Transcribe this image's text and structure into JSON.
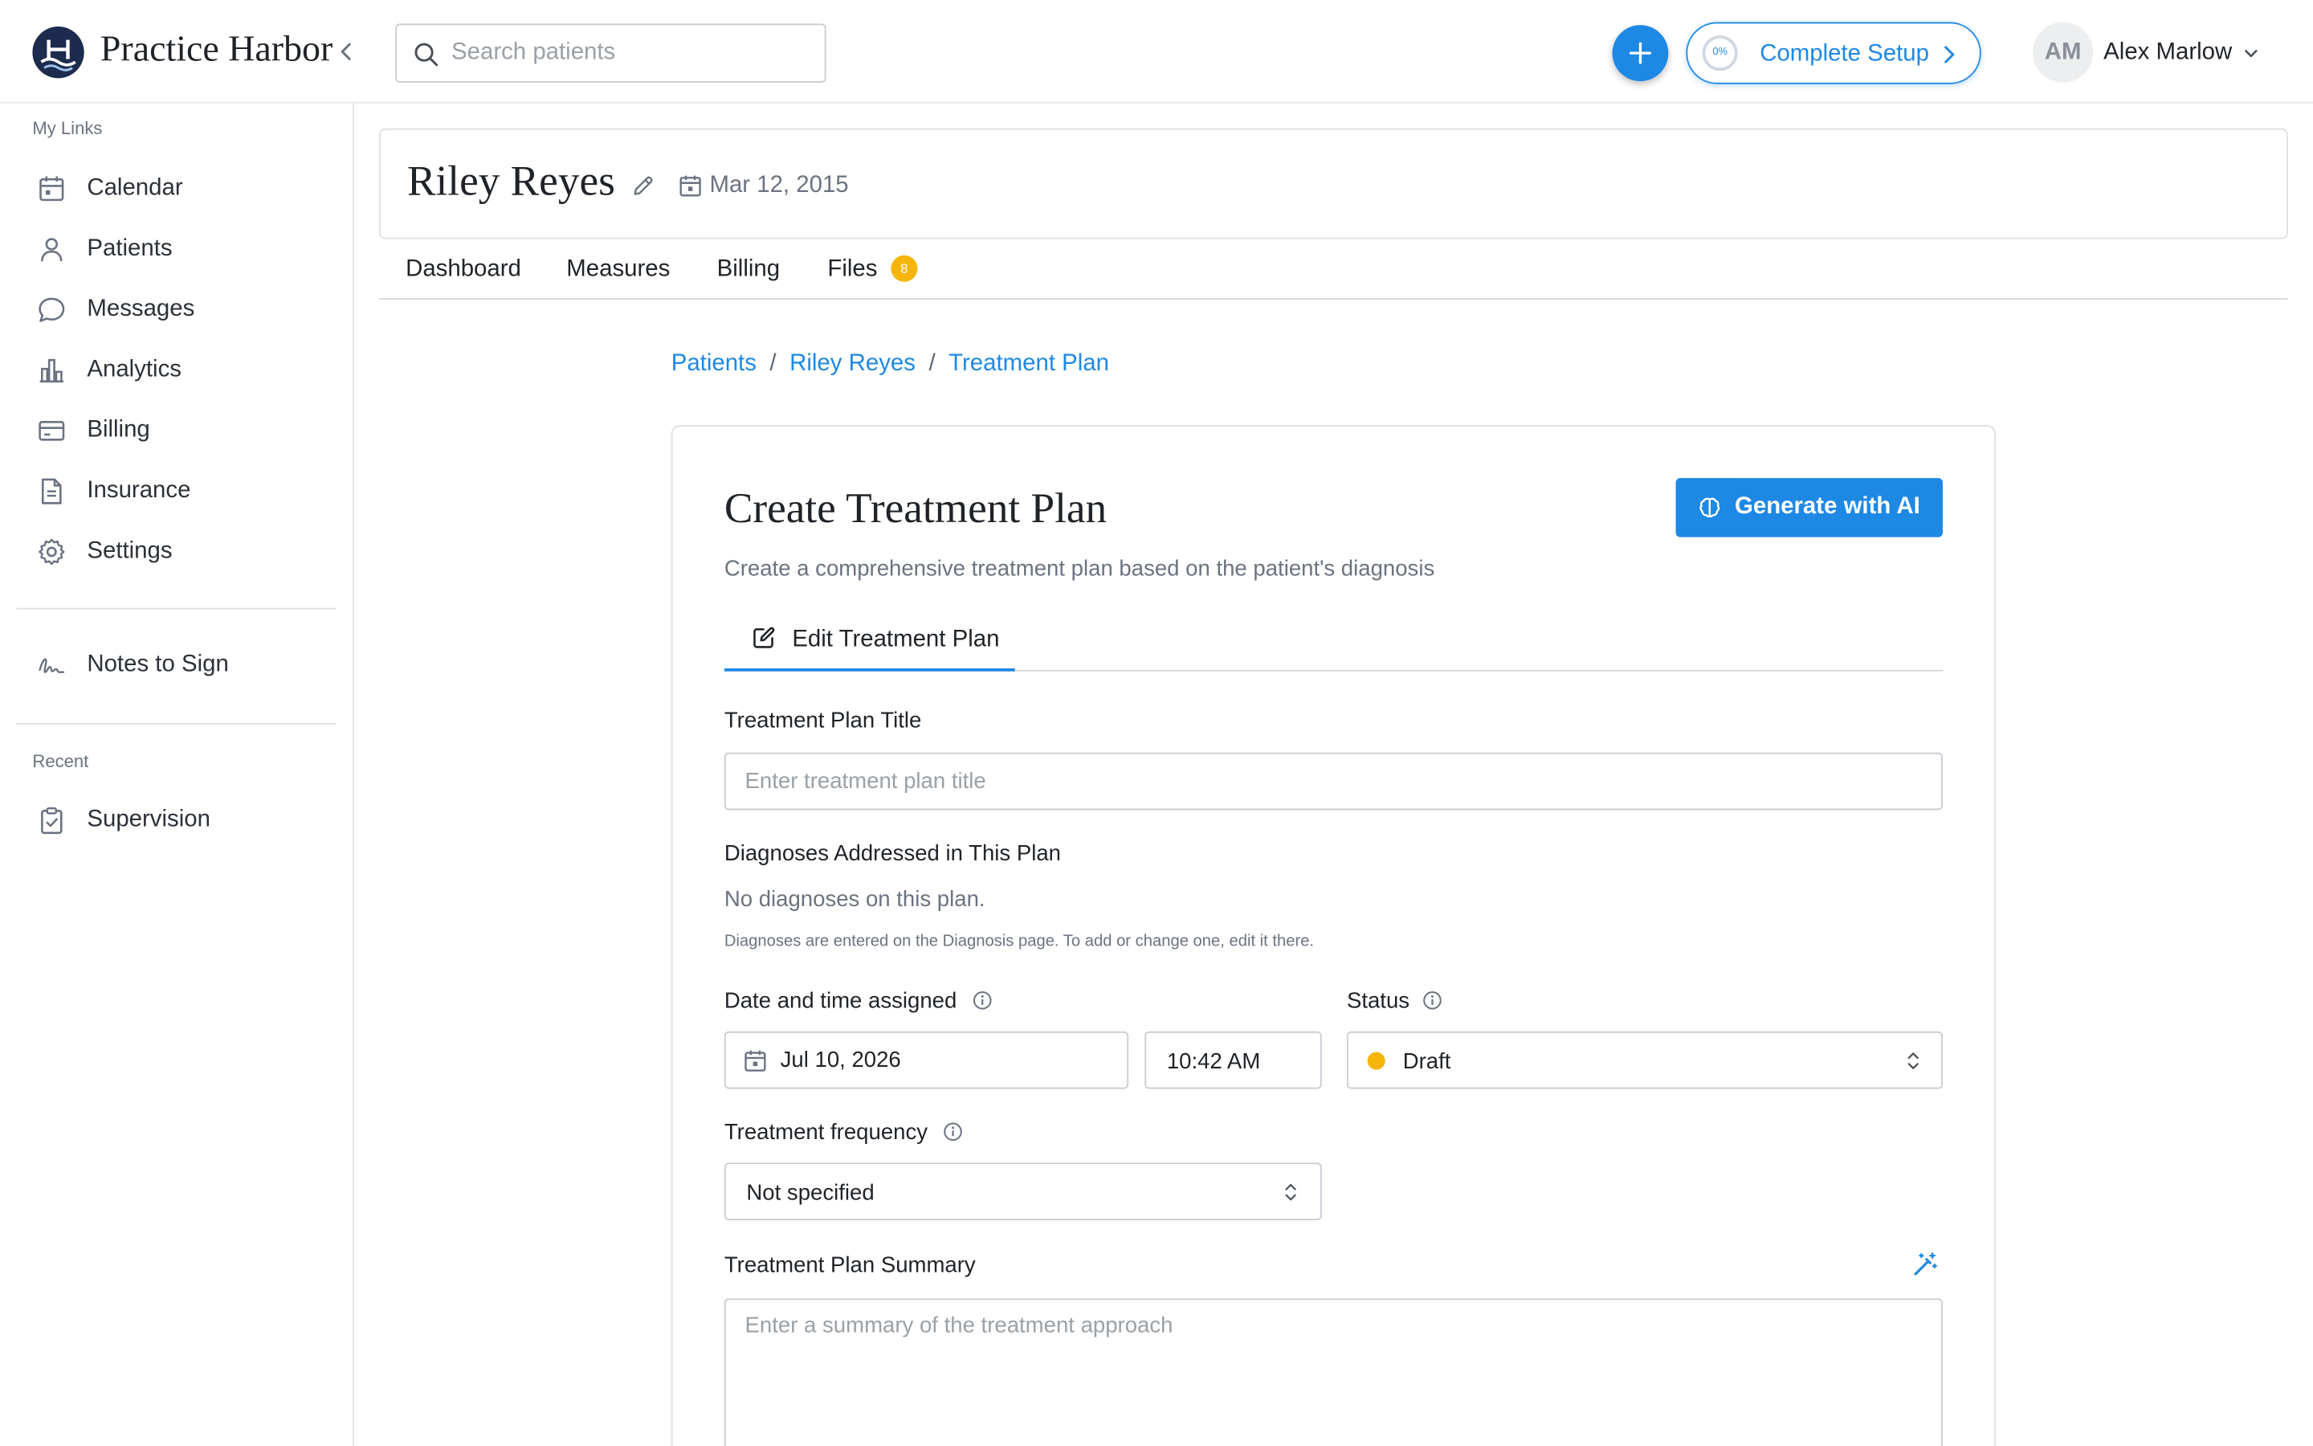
{
  "app": {
    "brand": "Practice Harbor"
  },
  "header": {
    "search_placeholder": "Search patients",
    "setup_progress": "0%",
    "setup_label": "Complete Setup",
    "user_initials": "AM",
    "user_name": "Alex Marlow"
  },
  "sidebar": {
    "section_links": "My Links",
    "items": [
      {
        "label": "Calendar",
        "icon": "calendar-icon"
      },
      {
        "label": "Patients",
        "icon": "person-icon"
      },
      {
        "label": "Messages",
        "icon": "chat-bubble-icon"
      },
      {
        "label": "Analytics",
        "icon": "bar-chart-icon"
      },
      {
        "label": "Billing",
        "icon": "credit-card-icon"
      },
      {
        "label": "Insurance",
        "icon": "document-icon"
      },
      {
        "label": "Settings",
        "icon": "gear-icon"
      }
    ],
    "notes_to_sign": "Notes to Sign",
    "section_recent": "Recent",
    "recent": [
      {
        "label": "Supervision",
        "icon": "clipboard-check-icon"
      }
    ]
  },
  "patient": {
    "name": "Riley Reyes",
    "dob": "Mar 12, 2015",
    "tabs": [
      "Dashboard",
      "Measures",
      "Billing",
      "Files"
    ],
    "files_count": "8"
  },
  "breadcrumb": [
    "Patients",
    "Riley Reyes",
    "Treatment Plan"
  ],
  "form": {
    "title": "Create Treatment Plan",
    "ai_button": "Generate with AI",
    "subtitle": "Create a comprehensive treatment plan based on the patient's diagnosis",
    "tab_edit": "Edit Treatment Plan",
    "plan_title_label": "Treatment Plan Title",
    "plan_title_placeholder": "Enter treatment plan title",
    "diagnoses_label": "Diagnoses Addressed in This Plan",
    "no_diagnoses": "No diagnoses on this plan.",
    "diagnoses_help": "Diagnoses are entered on the Diagnosis page. To add or change one, edit it there.",
    "date_label": "Date and time assigned",
    "date_value": "Jul 10, 2026",
    "time_value": "10:42 AM",
    "status_label": "Status",
    "status_value": "Draft",
    "status_color": "#f5b50a",
    "frequency_label": "Treatment frequency",
    "frequency_value": "Not specified",
    "summary_label": "Treatment Plan Summary",
    "summary_placeholder": "Enter a summary of the treatment approach"
  },
  "colors": {
    "accent": "#1e88e5",
    "brand_dark": "#1d2b4f",
    "badge": "#f5b50a"
  }
}
